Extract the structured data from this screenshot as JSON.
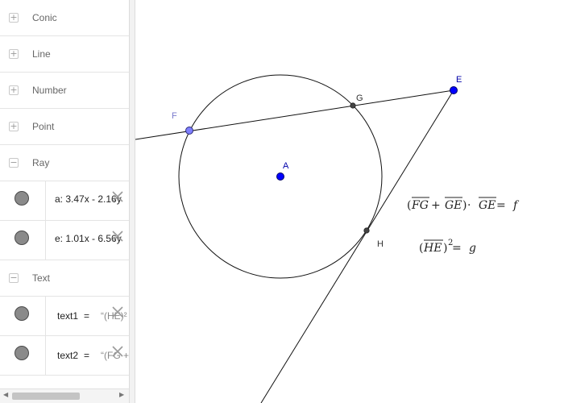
{
  "algebra": {
    "groups": {
      "conic": "Conic",
      "line": "Line",
      "number": "Number",
      "point": "Point",
      "ray": "Ray",
      "text": "Text"
    },
    "toggle_collapsed": "+",
    "toggle_expanded": "−",
    "rays": [
      {
        "definition": "a: 3.47x - 2.16y"
      },
      {
        "definition": "e: 1.01x - 6.56y"
      }
    ],
    "texts": [
      {
        "name": "text1",
        "equals": "=",
        "value": "“(HE)²"
      },
      {
        "name": "text2",
        "equals": "=",
        "value": "“(FG +"
      }
    ],
    "scroll_left": "◀",
    "scroll_right": "▶"
  },
  "graphics": {
    "points": {
      "A": "A",
      "E": "E",
      "F": "F",
      "G": "G",
      "H": "H"
    },
    "formula1": {
      "parts": [
        "(",
        "FG",
        " + ",
        "GE",
        ")",
        " · ",
        "GE",
        " = ",
        "f"
      ]
    },
    "formula2": {
      "parts": [
        "(",
        "HE",
        ")",
        "2",
        " = ",
        "g"
      ]
    },
    "colors": {
      "free_point": "#0000ff",
      "dependent_point": "#7f7fff",
      "intersection_point": "#444444",
      "label_free": "#0000aa",
      "label_dependent": "#7a7acc"
    }
  }
}
